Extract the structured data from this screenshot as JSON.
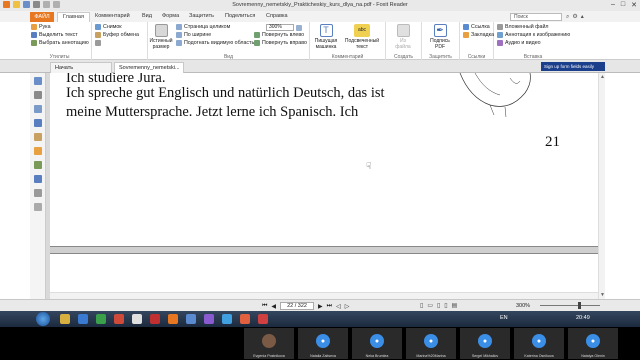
{
  "window": {
    "title": "Sovremenny_nemetskiy_Prakticheskiy_kurs_dlya_na.pdf - Foxit Reader",
    "controls": [
      "–",
      "□",
      "✕"
    ]
  },
  "ribbon_tabs": {
    "file": "ФАЙЛ",
    "tabs": [
      "Главная",
      "Комментарий",
      "Вид",
      "Форма",
      "Защитить",
      "Поделиться",
      "Справка"
    ],
    "search_placeholder": "Поиск"
  },
  "ribbon": {
    "tools": {
      "hand": "Рука",
      "select_text": "Выделить текст",
      "select_annotation": "Выбрать аннотацию",
      "group": "Утилиты"
    },
    "clipboard": {
      "snapshot": "Снимок",
      "clipboard": "Буфер обмена",
      "group": ""
    },
    "view": {
      "actual_size_1": "Истинный",
      "actual_size_2": "размер",
      "fit_page": "Страница целиком",
      "fit_width": "По ширине",
      "fit_visible": "Подогнать видимую область",
      "zoom": "300%",
      "rotate_left": "Повернуть влево",
      "rotate_right": "Повернуть вправо",
      "group": "Вид"
    },
    "comment": {
      "typewriter_1": "Пишущая",
      "typewriter_2": "машинка",
      "highlight": "Подсвеченный",
      "highlight_2": "текст",
      "abc": "abc",
      "group": "Комментарий"
    },
    "create": {
      "from_file_1": "Из",
      "from_file_2": "файла",
      "group": "Создать"
    },
    "protect": {
      "sign_1": "Подпись",
      "sign_2": "PDF",
      "group": "Защитить"
    },
    "links": {
      "link": "Ссылка",
      "bookmark": "Закладка",
      "group": "Ссылки"
    },
    "insert": {
      "attached_file": "Вложенный файл",
      "image_annotation": "Аннотация к изображению",
      "audio_video": "Аудио и видео",
      "group": "Вставка"
    }
  },
  "doc_tabs": {
    "start": "Начать",
    "doc": "Sovremenny_nemetski...",
    "tooltip": "Sign up form fields easily"
  },
  "document": {
    "line1": "Ich studiere Jura.",
    "line2": "Ich spreche gut Englisch und natürlich Deutsch, das ist",
    "line3": "meine Muttersprache. Jetzt lerne ich Spanisch. Ich",
    "page_number": "21"
  },
  "status": {
    "page_value": "22 / 322",
    "zoom": "300%"
  },
  "taskbar": {
    "lang": "EN",
    "time": "20:49"
  },
  "participants": [
    {
      "name": "Evgenia Postnikova",
      "kind": "photo"
    },
    {
      "name": "Natalia Zaitseva",
      "kind": "default"
    },
    {
      "name": "Neka Brumlea",
      "kind": "default"
    },
    {
      "name": "Marina%20Marina",
      "kind": "default"
    },
    {
      "name": "Sergei Mikhailov",
      "kind": "default"
    },
    {
      "name": "Katerina Osnikova",
      "kind": "default"
    },
    {
      "name": "Natalya Olenin",
      "kind": "default"
    }
  ],
  "colors": {
    "accent": "#e87722",
    "tooltip_bg": "#1c3f8c",
    "avatar_blue": "#3b8ee6"
  }
}
